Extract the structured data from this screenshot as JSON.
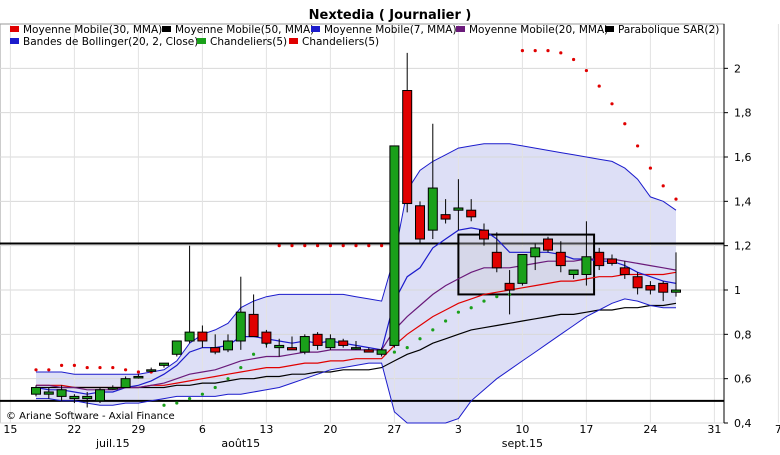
{
  "chart_data": {
    "type": "candlestick",
    "title": "Nextedia  ( Journalier )",
    "copyright": "© Ariane Software - Axial Finance",
    "legend": [
      {
        "label": "Moyenne Mobile(30, MMA)",
        "color": "#e00000"
      },
      {
        "label": "Moyenne Mobile(50, MMA)",
        "color": "#000000"
      },
      {
        "label": "Moyenne Mobile(7, MMA)",
        "color": "#1c1ccc"
      },
      {
        "label": "Moyenne Mobile(20, MMA)",
        "color": "#6a1a7a"
      },
      {
        "label": "Parabolique SAR(2)",
        "color": "#000000"
      },
      {
        "label": "Bandes de Bollinger(20, 2, Close)",
        "color": "#1c1ccc"
      },
      {
        "label": "Chandeliers(5)",
        "color": "#1aa01a"
      },
      {
        "label": "Chandeliers(5)",
        "color": "#e00000"
      }
    ],
    "y_ticks": [
      "0,4",
      "0,6",
      "0,8",
      "1",
      "1,2",
      "1,4",
      "1,6",
      "1,8",
      "2"
    ],
    "y_tick_values": [
      0.4,
      0.6,
      0.8,
      1.0,
      1.2,
      1.4,
      1.6,
      1.8,
      2.0
    ],
    "ylim": [
      0.4,
      2.2
    ],
    "x_ticks": [
      "15",
      "22",
      "29",
      "6",
      "13",
      "20",
      "27",
      "3",
      "10",
      "17",
      "24",
      "31",
      "7"
    ],
    "months": [
      "juil.15",
      "août15",
      "sept.15"
    ],
    "horizontal_lines": [
      1.21,
      0.5
    ],
    "box": {
      "x_from": 33.0,
      "x_to": 43.6,
      "y_from": 0.98,
      "y_to": 1.25
    },
    "candles": [
      {
        "o": 0.53,
        "h": 0.57,
        "l": 0.52,
        "c": 0.56
      },
      {
        "o": 0.53,
        "h": 0.56,
        "l": 0.51,
        "c": 0.54
      },
      {
        "o": 0.52,
        "h": 0.57,
        "l": 0.5,
        "c": 0.55
      },
      {
        "o": 0.51,
        "h": 0.53,
        "l": 0.49,
        "c": 0.52
      },
      {
        "o": 0.51,
        "h": 0.54,
        "l": 0.47,
        "c": 0.52
      },
      {
        "o": 0.5,
        "h": 0.56,
        "l": 0.49,
        "c": 0.55
      },
      {
        "o": 0.56,
        "h": 0.57,
        "l": 0.55,
        "c": 0.56
      },
      {
        "o": 0.56,
        "h": 0.61,
        "l": 0.56,
        "c": 0.6
      },
      {
        "o": 0.61,
        "h": 0.62,
        "l": 0.6,
        "c": 0.61
      },
      {
        "o": 0.64,
        "h": 0.65,
        "l": 0.63,
        "c": 0.64
      },
      {
        "o": 0.66,
        "h": 0.67,
        "l": 0.65,
        "c": 0.67
      },
      {
        "o": 0.71,
        "h": 0.77,
        "l": 0.7,
        "c": 0.77
      },
      {
        "o": 0.77,
        "h": 1.2,
        "l": 0.76,
        "c": 0.81
      },
      {
        "o": 0.81,
        "h": 0.84,
        "l": 0.74,
        "c": 0.77
      },
      {
        "o": 0.74,
        "h": 0.8,
        "l": 0.71,
        "c": 0.72
      },
      {
        "o": 0.73,
        "h": 0.8,
        "l": 0.72,
        "c": 0.77
      },
      {
        "o": 0.77,
        "h": 1.06,
        "l": 0.73,
        "c": 0.9
      },
      {
        "o": 0.89,
        "h": 0.98,
        "l": 0.8,
        "c": 0.79
      },
      {
        "o": 0.81,
        "h": 0.82,
        "l": 0.74,
        "c": 0.76
      },
      {
        "o": 0.74,
        "h": 0.78,
        "l": 0.7,
        "c": 0.75
      },
      {
        "o": 0.74,
        "h": 0.79,
        "l": 0.73,
        "c": 0.73
      },
      {
        "o": 0.72,
        "h": 0.8,
        "l": 0.71,
        "c": 0.79
      },
      {
        "o": 0.8,
        "h": 0.81,
        "l": 0.73,
        "c": 0.75
      },
      {
        "o": 0.74,
        "h": 0.8,
        "l": 0.73,
        "c": 0.78
      },
      {
        "o": 0.77,
        "h": 0.78,
        "l": 0.74,
        "c": 0.75
      },
      {
        "o": 0.74,
        "h": 0.77,
        "l": 0.73,
        "c": 0.74
      },
      {
        "o": 0.73,
        "h": 0.74,
        "l": 0.72,
        "c": 0.72
      },
      {
        "o": 0.71,
        "h": 0.74,
        "l": 0.7,
        "c": 0.73
      },
      {
        "o": 0.75,
        "h": 1.65,
        "l": 0.74,
        "c": 1.65
      },
      {
        "o": 1.9,
        "h": 2.07,
        "l": 1.35,
        "c": 1.39
      },
      {
        "o": 1.38,
        "h": 1.4,
        "l": 1.21,
        "c": 1.23
      },
      {
        "o": 1.27,
        "h": 1.75,
        "l": 1.23,
        "c": 1.46
      },
      {
        "o": 1.34,
        "h": 1.41,
        "l": 1.3,
        "c": 1.32
      },
      {
        "o": 1.36,
        "h": 1.5,
        "l": 1.27,
        "c": 1.37
      },
      {
        "o": 1.36,
        "h": 1.41,
        "l": 1.31,
        "c": 1.33
      },
      {
        "o": 1.27,
        "h": 1.3,
        "l": 1.2,
        "c": 1.23
      },
      {
        "o": 1.17,
        "h": 1.26,
        "l": 1.08,
        "c": 1.1
      },
      {
        "o": 1.03,
        "h": 1.09,
        "l": 0.89,
        "c": 1.0
      },
      {
        "o": 1.03,
        "h": 1.16,
        "l": 1.02,
        "c": 1.16
      },
      {
        "o": 1.15,
        "h": 1.21,
        "l": 1.09,
        "c": 1.19
      },
      {
        "o": 1.23,
        "h": 1.24,
        "l": 1.17,
        "c": 1.18
      },
      {
        "o": 1.17,
        "h": 1.22,
        "l": 1.08,
        "c": 1.11
      },
      {
        "o": 1.07,
        "h": 1.08,
        "l": 1.05,
        "c": 1.09
      },
      {
        "o": 1.07,
        "h": 1.31,
        "l": 1.02,
        "c": 1.15
      },
      {
        "o": 1.17,
        "h": 1.19,
        "l": 1.09,
        "c": 1.11
      },
      {
        "o": 1.14,
        "h": 1.16,
        "l": 1.11,
        "c": 1.12
      },
      {
        "o": 1.1,
        "h": 1.13,
        "l": 1.05,
        "c": 1.07
      },
      {
        "o": 1.06,
        "h": 1.08,
        "l": 0.98,
        "c": 1.01
      },
      {
        "o": 1.02,
        "h": 1.04,
        "l": 0.98,
        "c": 1.0
      },
      {
        "o": 1.03,
        "h": 1.04,
        "l": 0.95,
        "c": 0.99
      },
      {
        "o": 0.99,
        "h": 1.17,
        "l": 0.97,
        "c": 1.0
      }
    ],
    "series": [
      {
        "name": "Moyenne Mobile(30, MMA)",
        "color": "#e00000",
        "values": [
          0.57,
          0.57,
          0.57,
          0.56,
          0.56,
          0.56,
          0.56,
          0.56,
          0.56,
          0.57,
          0.57,
          0.58,
          0.59,
          0.6,
          0.61,
          0.62,
          0.63,
          0.64,
          0.65,
          0.65,
          0.66,
          0.67,
          0.67,
          0.68,
          0.68,
          0.69,
          0.69,
          0.69,
          0.75,
          0.8,
          0.84,
          0.88,
          0.91,
          0.94,
          0.96,
          0.98,
          0.99,
          1.0,
          1.01,
          1.02,
          1.03,
          1.04,
          1.04,
          1.05,
          1.06,
          1.06,
          1.07,
          1.07,
          1.07,
          1.07,
          1.08
        ]
      },
      {
        "name": "Moyenne Mobile(50, MMA)",
        "color": "#000000",
        "values": [
          0.56,
          0.56,
          0.56,
          0.56,
          0.56,
          0.56,
          0.56,
          0.56,
          0.56,
          0.56,
          0.56,
          0.57,
          0.57,
          0.58,
          0.58,
          0.59,
          0.6,
          0.6,
          0.61,
          0.61,
          0.62,
          0.62,
          0.63,
          0.63,
          0.64,
          0.64,
          0.64,
          0.65,
          0.68,
          0.71,
          0.73,
          0.76,
          0.78,
          0.8,
          0.82,
          0.83,
          0.84,
          0.85,
          0.86,
          0.87,
          0.88,
          0.89,
          0.89,
          0.9,
          0.91,
          0.91,
          0.92,
          0.92,
          0.93,
          0.93,
          0.94
        ]
      },
      {
        "name": "Moyenne Mobile(7, MMA)",
        "color": "#1c1ccc",
        "values": [
          0.56,
          0.55,
          0.55,
          0.54,
          0.53,
          0.54,
          0.54,
          0.56,
          0.57,
          0.59,
          0.62,
          0.66,
          0.72,
          0.74,
          0.74,
          0.75,
          0.79,
          0.79,
          0.78,
          0.77,
          0.76,
          0.77,
          0.76,
          0.77,
          0.76,
          0.75,
          0.74,
          0.73,
          0.95,
          1.06,
          1.1,
          1.19,
          1.23,
          1.27,
          1.28,
          1.27,
          1.23,
          1.17,
          1.17,
          1.17,
          1.17,
          1.16,
          1.14,
          1.14,
          1.13,
          1.13,
          1.11,
          1.08,
          1.06,
          1.04,
          1.03
        ]
      },
      {
        "name": "Moyenne Mobile(20, MMA)",
        "color": "#6a1a7a",
        "values": [
          0.57,
          0.57,
          0.56,
          0.56,
          0.55,
          0.55,
          0.55,
          0.56,
          0.56,
          0.57,
          0.58,
          0.6,
          0.62,
          0.63,
          0.64,
          0.66,
          0.68,
          0.69,
          0.7,
          0.7,
          0.71,
          0.72,
          0.72,
          0.73,
          0.73,
          0.73,
          0.73,
          0.73,
          0.82,
          0.88,
          0.93,
          0.98,
          1.02,
          1.05,
          1.08,
          1.1,
          1.1,
          1.1,
          1.11,
          1.12,
          1.13,
          1.13,
          1.13,
          1.14,
          1.14,
          1.14,
          1.13,
          1.12,
          1.11,
          1.1,
          1.09
        ]
      },
      {
        "name": "Bandes de Bollinger(20, 2, Close) sup",
        "color": "#1c1ccc",
        "values": [
          0.63,
          0.63,
          0.63,
          0.62,
          0.62,
          0.62,
          0.62,
          0.62,
          0.62,
          0.63,
          0.64,
          0.68,
          0.76,
          0.8,
          0.82,
          0.85,
          0.92,
          0.95,
          0.97,
          0.98,
          0.98,
          0.98,
          0.98,
          0.98,
          0.98,
          0.97,
          0.96,
          0.95,
          1.15,
          1.45,
          1.54,
          1.58,
          1.61,
          1.64,
          1.65,
          1.66,
          1.66,
          1.66,
          1.65,
          1.64,
          1.63,
          1.62,
          1.61,
          1.6,
          1.59,
          1.58,
          1.55,
          1.5,
          1.42,
          1.4,
          1.36
        ]
      },
      {
        "name": "Bandes de Bollinger(20, 2, Close) inf",
        "color": "#1c1ccc",
        "values": [
          0.51,
          0.51,
          0.5,
          0.5,
          0.49,
          0.48,
          0.48,
          0.49,
          0.49,
          0.5,
          0.51,
          0.52,
          0.52,
          0.52,
          0.52,
          0.53,
          0.53,
          0.54,
          0.55,
          0.56,
          0.58,
          0.6,
          0.62,
          0.64,
          0.65,
          0.66,
          0.67,
          0.67,
          0.45,
          0.3,
          0.3,
          0.3,
          0.35,
          0.42,
          0.5,
          0.55,
          0.6,
          0.64,
          0.68,
          0.72,
          0.76,
          0.8,
          0.84,
          0.88,
          0.91,
          0.94,
          0.96,
          0.95,
          0.93,
          0.92,
          0.92
        ]
      }
    ],
    "sar": [
      {
        "i": 0,
        "v": 0.64
      },
      {
        "i": 1,
        "v": 0.64
      },
      {
        "i": 2,
        "v": 0.66
      },
      {
        "i": 3,
        "v": 0.66
      },
      {
        "i": 4,
        "v": 0.65
      },
      {
        "i": 5,
        "v": 0.65
      },
      {
        "i": 6,
        "v": 0.65
      },
      {
        "i": 7,
        "v": 0.64
      },
      {
        "i": 8,
        "v": 0.63
      },
      {
        "i": 9,
        "v": 0.63
      },
      {
        "i": 10,
        "v": 0.48
      },
      {
        "i": 11,
        "v": 0.49
      },
      {
        "i": 12,
        "v": 0.51
      },
      {
        "i": 13,
        "v": 0.53
      },
      {
        "i": 14,
        "v": 0.56
      },
      {
        "i": 15,
        "v": 0.6
      },
      {
        "i": 16,
        "v": 0.65
      },
      {
        "i": 17,
        "v": 0.71
      },
      {
        "i": 18,
        "v": 0.76
      },
      {
        "i": 19,
        "v": 1.2
      },
      {
        "i": 20,
        "v": 1.2
      },
      {
        "i": 21,
        "v": 1.2
      },
      {
        "i": 22,
        "v": 1.2
      },
      {
        "i": 23,
        "v": 1.2
      },
      {
        "i": 24,
        "v": 1.2
      },
      {
        "i": 25,
        "v": 1.2
      },
      {
        "i": 26,
        "v": 1.2
      },
      {
        "i": 27,
        "v": 1.2
      },
      {
        "i": 28,
        "v": 0.72
      },
      {
        "i": 29,
        "v": 0.74
      },
      {
        "i": 30,
        "v": 0.78
      },
      {
        "i": 31,
        "v": 0.82
      },
      {
        "i": 32,
        "v": 0.86
      },
      {
        "i": 33,
        "v": 0.9
      },
      {
        "i": 34,
        "v": 0.92
      },
      {
        "i": 35,
        "v": 0.95
      },
      {
        "i": 36,
        "v": 0.97
      },
      {
        "i": 37,
        "v": 0.98
      },
      {
        "i": 38,
        "v": 2.08
      },
      {
        "i": 39,
        "v": 2.08
      },
      {
        "i": 40,
        "v": 2.08
      },
      {
        "i": 41,
        "v": 2.07
      },
      {
        "i": 42,
        "v": 2.04
      },
      {
        "i": 43,
        "v": 1.99
      },
      {
        "i": 44,
        "v": 1.92
      },
      {
        "i": 45,
        "v": 1.84
      },
      {
        "i": 46,
        "v": 1.75
      },
      {
        "i": 47,
        "v": 1.65
      },
      {
        "i": 48,
        "v": 1.55
      },
      {
        "i": 49,
        "v": 1.47
      },
      {
        "i": 50,
        "v": 1.41
      }
    ]
  }
}
